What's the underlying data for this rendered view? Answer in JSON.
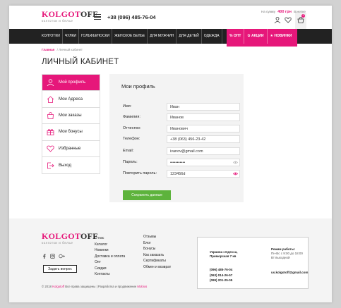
{
  "header": {
    "logo_main_pink": "KOLGOT",
    "logo_main_dark": "OFF",
    "logo_sub": "колготки и белье",
    "phone": "+38 (096) 485-76-04",
    "cart_label_before": "На сумму",
    "cart_sum": "400 грн",
    "cart_label_after": "Вокупке",
    "cart_count": "3"
  },
  "nav": {
    "items": [
      "Колготки",
      "Чулки",
      "Гольфы/носки",
      "Женское белье",
      "Для мужчин",
      "Для детей",
      "Одежда"
    ],
    "opt": "Опт",
    "sale": "Акции",
    "new": "Новинки"
  },
  "breadcrumb": {
    "home": "Главная",
    "sep": "/",
    "current": "Личный кабинет"
  },
  "page_title": "ЛИЧНЫЙ КАБИНЕТ",
  "sidebar": {
    "items": [
      {
        "label": "Мой профиль",
        "icon": "user-icon"
      },
      {
        "label": "Мои Адреса",
        "icon": "home-icon"
      },
      {
        "label": "Мои заказы",
        "icon": "bag-icon"
      },
      {
        "label": "Мои бонусы",
        "icon": "gift-icon"
      },
      {
        "label": "Избранные",
        "icon": "heart-icon"
      },
      {
        "label": "Выход",
        "icon": "logout-icon"
      }
    ]
  },
  "profile": {
    "title": "Мои профиль",
    "fields": [
      {
        "label": "Имя:",
        "value": "Иван"
      },
      {
        "label": "Фамилия:",
        "value": "Иванов"
      },
      {
        "label": "Отчество:",
        "value": "Иванович"
      },
      {
        "label": "Телефон:",
        "value": "+38 (063) 456-23-42"
      },
      {
        "label": "Email:",
        "value": "ivanov@gmail.com"
      },
      {
        "label": "Пароль:",
        "value": "•••••••••••"
      },
      {
        "label": "Повторить пароль:",
        "value": "123456d"
      }
    ],
    "save_label": "Сохранить данные",
    "colors": {
      "accent": "#e6177a",
      "save": "#5db33c"
    }
  },
  "footer": {
    "col1": [
      "О нас",
      "Каталог",
      "Новинки",
      "Доставка и оплата",
      "Опт",
      "Скидки",
      "Контакты"
    ],
    "col2": [
      "Отзывы",
      "Блог",
      "Бонусы",
      "Как заказать",
      "Сертификаты",
      "Обмен и возврат"
    ],
    "ask_label": "Задать вопрос",
    "copyright_pre": "© 2018",
    "copyright_brand": "Kolgotoff",
    "copyright_post": "Все права защищены | Разработка и продвижение",
    "copyright_dev": "Mobios",
    "contact": {
      "address_line1": "Украина г.Одесса,",
      "address_line2": "Приморская 7 кв",
      "phones": [
        "(096) 485-76-04",
        "(063) 014-26-57",
        "(099) 201-25-05"
      ],
      "schedule_title": "Режим работы:",
      "schedule_line1": "Пн-Вс с 9:00 до 18:00",
      "schedule_line2": "Вт выходной",
      "email": "us.kolgotoff@gmail.com"
    }
  }
}
